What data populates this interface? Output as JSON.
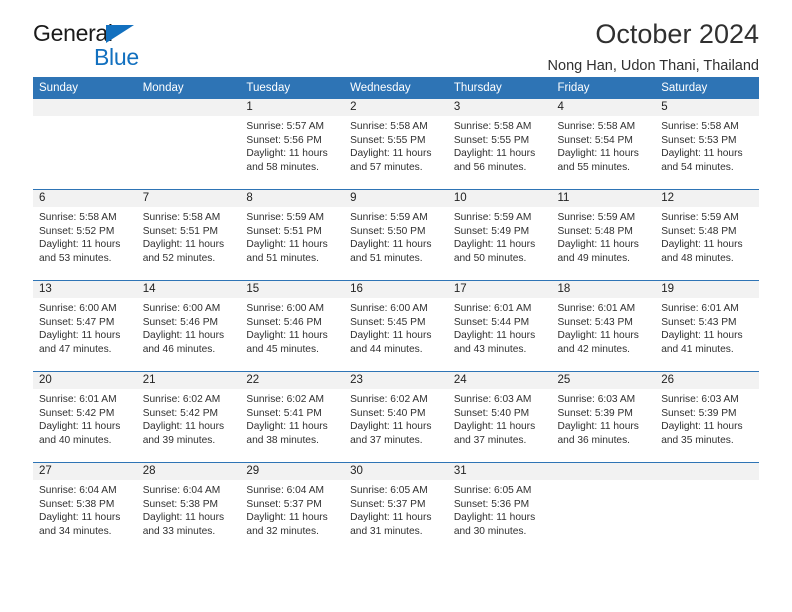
{
  "brand": {
    "name_part1": "General",
    "name_part2": "Blue",
    "triangle_color": "#1270bf"
  },
  "header": {
    "title": "October 2024",
    "subtitle": "Nong Han, Udon Thani, Thailand",
    "accent_color": "#2e74b5"
  },
  "weekday_headers": [
    "Sunday",
    "Monday",
    "Tuesday",
    "Wednesday",
    "Thursday",
    "Friday",
    "Saturday"
  ],
  "weeks": [
    [
      {
        "day": "",
        "sunrise": "",
        "sunset": "",
        "daylight_line1": "",
        "daylight_line2": ""
      },
      {
        "day": "",
        "sunrise": "",
        "sunset": "",
        "daylight_line1": "",
        "daylight_line2": ""
      },
      {
        "day": "1",
        "sunrise": "Sunrise: 5:57 AM",
        "sunset": "Sunset: 5:56 PM",
        "daylight_line1": "Daylight: 11 hours",
        "daylight_line2": "and 58 minutes."
      },
      {
        "day": "2",
        "sunrise": "Sunrise: 5:58 AM",
        "sunset": "Sunset: 5:55 PM",
        "daylight_line1": "Daylight: 11 hours",
        "daylight_line2": "and 57 minutes."
      },
      {
        "day": "3",
        "sunrise": "Sunrise: 5:58 AM",
        "sunset": "Sunset: 5:55 PM",
        "daylight_line1": "Daylight: 11 hours",
        "daylight_line2": "and 56 minutes."
      },
      {
        "day": "4",
        "sunrise": "Sunrise: 5:58 AM",
        "sunset": "Sunset: 5:54 PM",
        "daylight_line1": "Daylight: 11 hours",
        "daylight_line2": "and 55 minutes."
      },
      {
        "day": "5",
        "sunrise": "Sunrise: 5:58 AM",
        "sunset": "Sunset: 5:53 PM",
        "daylight_line1": "Daylight: 11 hours",
        "daylight_line2": "and 54 minutes."
      }
    ],
    [
      {
        "day": "6",
        "sunrise": "Sunrise: 5:58 AM",
        "sunset": "Sunset: 5:52 PM",
        "daylight_line1": "Daylight: 11 hours",
        "daylight_line2": "and 53 minutes."
      },
      {
        "day": "7",
        "sunrise": "Sunrise: 5:58 AM",
        "sunset": "Sunset: 5:51 PM",
        "daylight_line1": "Daylight: 11 hours",
        "daylight_line2": "and 52 minutes."
      },
      {
        "day": "8",
        "sunrise": "Sunrise: 5:59 AM",
        "sunset": "Sunset: 5:51 PM",
        "daylight_line1": "Daylight: 11 hours",
        "daylight_line2": "and 51 minutes."
      },
      {
        "day": "9",
        "sunrise": "Sunrise: 5:59 AM",
        "sunset": "Sunset: 5:50 PM",
        "daylight_line1": "Daylight: 11 hours",
        "daylight_line2": "and 51 minutes."
      },
      {
        "day": "10",
        "sunrise": "Sunrise: 5:59 AM",
        "sunset": "Sunset: 5:49 PM",
        "daylight_line1": "Daylight: 11 hours",
        "daylight_line2": "and 50 minutes."
      },
      {
        "day": "11",
        "sunrise": "Sunrise: 5:59 AM",
        "sunset": "Sunset: 5:48 PM",
        "daylight_line1": "Daylight: 11 hours",
        "daylight_line2": "and 49 minutes."
      },
      {
        "day": "12",
        "sunrise": "Sunrise: 5:59 AM",
        "sunset": "Sunset: 5:48 PM",
        "daylight_line1": "Daylight: 11 hours",
        "daylight_line2": "and 48 minutes."
      }
    ],
    [
      {
        "day": "13",
        "sunrise": "Sunrise: 6:00 AM",
        "sunset": "Sunset: 5:47 PM",
        "daylight_line1": "Daylight: 11 hours",
        "daylight_line2": "and 47 minutes."
      },
      {
        "day": "14",
        "sunrise": "Sunrise: 6:00 AM",
        "sunset": "Sunset: 5:46 PM",
        "daylight_line1": "Daylight: 11 hours",
        "daylight_line2": "and 46 minutes."
      },
      {
        "day": "15",
        "sunrise": "Sunrise: 6:00 AM",
        "sunset": "Sunset: 5:46 PM",
        "daylight_line1": "Daylight: 11 hours",
        "daylight_line2": "and 45 minutes."
      },
      {
        "day": "16",
        "sunrise": "Sunrise: 6:00 AM",
        "sunset": "Sunset: 5:45 PM",
        "daylight_line1": "Daylight: 11 hours",
        "daylight_line2": "and 44 minutes."
      },
      {
        "day": "17",
        "sunrise": "Sunrise: 6:01 AM",
        "sunset": "Sunset: 5:44 PM",
        "daylight_line1": "Daylight: 11 hours",
        "daylight_line2": "and 43 minutes."
      },
      {
        "day": "18",
        "sunrise": "Sunrise: 6:01 AM",
        "sunset": "Sunset: 5:43 PM",
        "daylight_line1": "Daylight: 11 hours",
        "daylight_line2": "and 42 minutes."
      },
      {
        "day": "19",
        "sunrise": "Sunrise: 6:01 AM",
        "sunset": "Sunset: 5:43 PM",
        "daylight_line1": "Daylight: 11 hours",
        "daylight_line2": "and 41 minutes."
      }
    ],
    [
      {
        "day": "20",
        "sunrise": "Sunrise: 6:01 AM",
        "sunset": "Sunset: 5:42 PM",
        "daylight_line1": "Daylight: 11 hours",
        "daylight_line2": "and 40 minutes."
      },
      {
        "day": "21",
        "sunrise": "Sunrise: 6:02 AM",
        "sunset": "Sunset: 5:42 PM",
        "daylight_line1": "Daylight: 11 hours",
        "daylight_line2": "and 39 minutes."
      },
      {
        "day": "22",
        "sunrise": "Sunrise: 6:02 AM",
        "sunset": "Sunset: 5:41 PM",
        "daylight_line1": "Daylight: 11 hours",
        "daylight_line2": "and 38 minutes."
      },
      {
        "day": "23",
        "sunrise": "Sunrise: 6:02 AM",
        "sunset": "Sunset: 5:40 PM",
        "daylight_line1": "Daylight: 11 hours",
        "daylight_line2": "and 37 minutes."
      },
      {
        "day": "24",
        "sunrise": "Sunrise: 6:03 AM",
        "sunset": "Sunset: 5:40 PM",
        "daylight_line1": "Daylight: 11 hours",
        "daylight_line2": "and 37 minutes."
      },
      {
        "day": "25",
        "sunrise": "Sunrise: 6:03 AM",
        "sunset": "Sunset: 5:39 PM",
        "daylight_line1": "Daylight: 11 hours",
        "daylight_line2": "and 36 minutes."
      },
      {
        "day": "26",
        "sunrise": "Sunrise: 6:03 AM",
        "sunset": "Sunset: 5:39 PM",
        "daylight_line1": "Daylight: 11 hours",
        "daylight_line2": "and 35 minutes."
      }
    ],
    [
      {
        "day": "27",
        "sunrise": "Sunrise: 6:04 AM",
        "sunset": "Sunset: 5:38 PM",
        "daylight_line1": "Daylight: 11 hours",
        "daylight_line2": "and 34 minutes."
      },
      {
        "day": "28",
        "sunrise": "Sunrise: 6:04 AM",
        "sunset": "Sunset: 5:38 PM",
        "daylight_line1": "Daylight: 11 hours",
        "daylight_line2": "and 33 minutes."
      },
      {
        "day": "29",
        "sunrise": "Sunrise: 6:04 AM",
        "sunset": "Sunset: 5:37 PM",
        "daylight_line1": "Daylight: 11 hours",
        "daylight_line2": "and 32 minutes."
      },
      {
        "day": "30",
        "sunrise": "Sunrise: 6:05 AM",
        "sunset": "Sunset: 5:37 PM",
        "daylight_line1": "Daylight: 11 hours",
        "daylight_line2": "and 31 minutes."
      },
      {
        "day": "31",
        "sunrise": "Sunrise: 6:05 AM",
        "sunset": "Sunset: 5:36 PM",
        "daylight_line1": "Daylight: 11 hours",
        "daylight_line2": "and 30 minutes."
      },
      {
        "day": "",
        "sunrise": "",
        "sunset": "",
        "daylight_line1": "",
        "daylight_line2": ""
      },
      {
        "day": "",
        "sunrise": "",
        "sunset": "",
        "daylight_line1": "",
        "daylight_line2": ""
      }
    ]
  ]
}
